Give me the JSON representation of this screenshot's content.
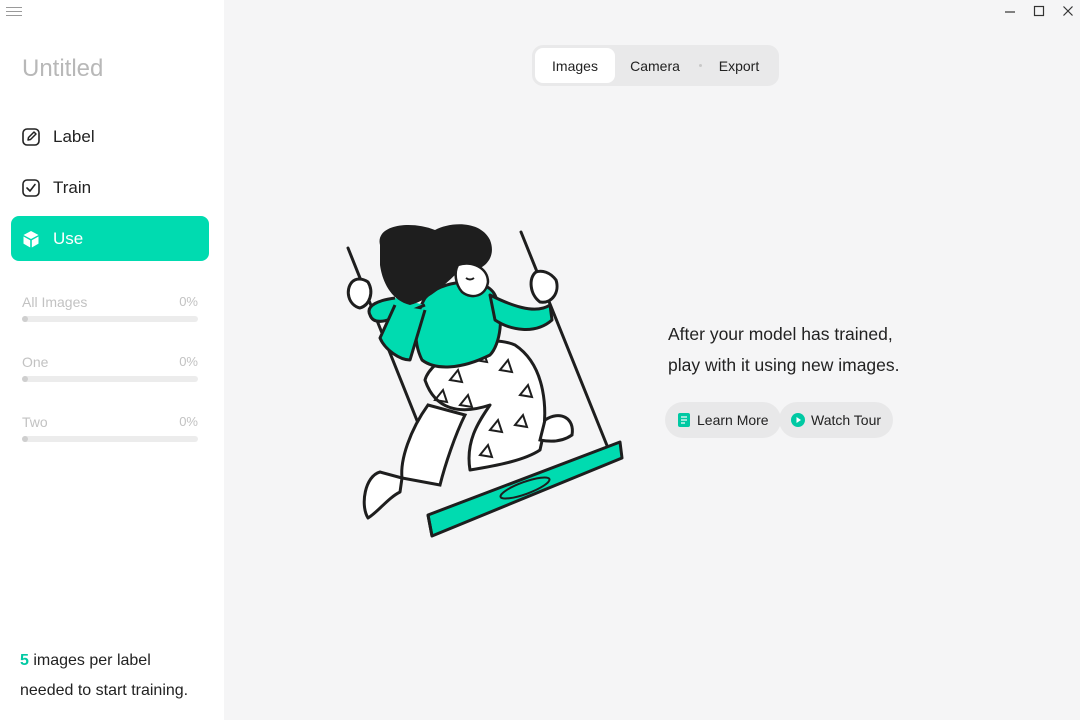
{
  "project": {
    "title": "Untitled"
  },
  "nav": [
    {
      "label": "Label",
      "icon": "pencil-icon",
      "active": false
    },
    {
      "label": "Train",
      "icon": "checkbox-icon",
      "active": false
    },
    {
      "label": "Use",
      "icon": "cube-icon",
      "active": true
    }
  ],
  "classes": [
    {
      "name": "All Images",
      "percent": "0%",
      "progress": 0
    },
    {
      "name": "One",
      "percent": "0%",
      "progress": 0
    },
    {
      "name": "Two",
      "percent": "0%",
      "progress": 0
    }
  ],
  "footer": {
    "count": "5",
    "text_line1": " images per label",
    "text_line2": "needed to start training."
  },
  "tabs": [
    {
      "label": "Images",
      "active": true
    },
    {
      "label": "Camera",
      "active": false
    },
    {
      "label": "Export",
      "active": false
    }
  ],
  "main": {
    "message_line1": "After your model has trained,",
    "message_line2": "play with it using new images.",
    "learn_more_label": "Learn More",
    "watch_tour_label": "Watch Tour"
  },
  "colors": {
    "accent": "#00dbb0",
    "background": "#f5f5f6",
    "sidebar": "#ffffff",
    "muted_text": "#b8b8b8"
  },
  "window_controls": [
    "minimize-icon",
    "maximize-icon",
    "close-icon"
  ]
}
